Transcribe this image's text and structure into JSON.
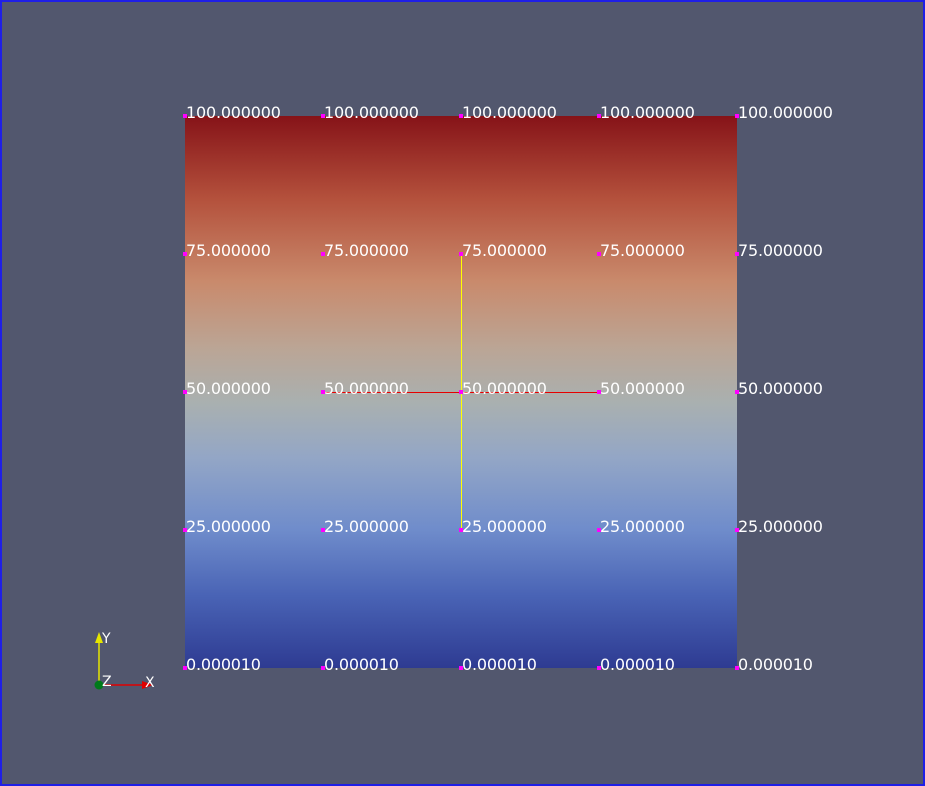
{
  "viewport": {
    "background": "#52576e",
    "border_color": "#1f1fe6"
  },
  "node_marker_color": "#ff00ff",
  "node_rows": [
    {
      "label": "100.000000"
    },
    {
      "label": "75.000000"
    },
    {
      "label": "50.000000"
    },
    {
      "label": "25.000000"
    },
    {
      "label": "0.000010"
    }
  ],
  "node_columns": 5,
  "selection": {
    "vertical_color": "#ffff00",
    "horizontal_color": "#e60000"
  },
  "orientation_axes": {
    "x_label": "X",
    "y_label": "Y",
    "z_label": "Z",
    "x_color": "#e00000",
    "y_color": "#e6e600",
    "z_color": "#007a1a"
  }
}
